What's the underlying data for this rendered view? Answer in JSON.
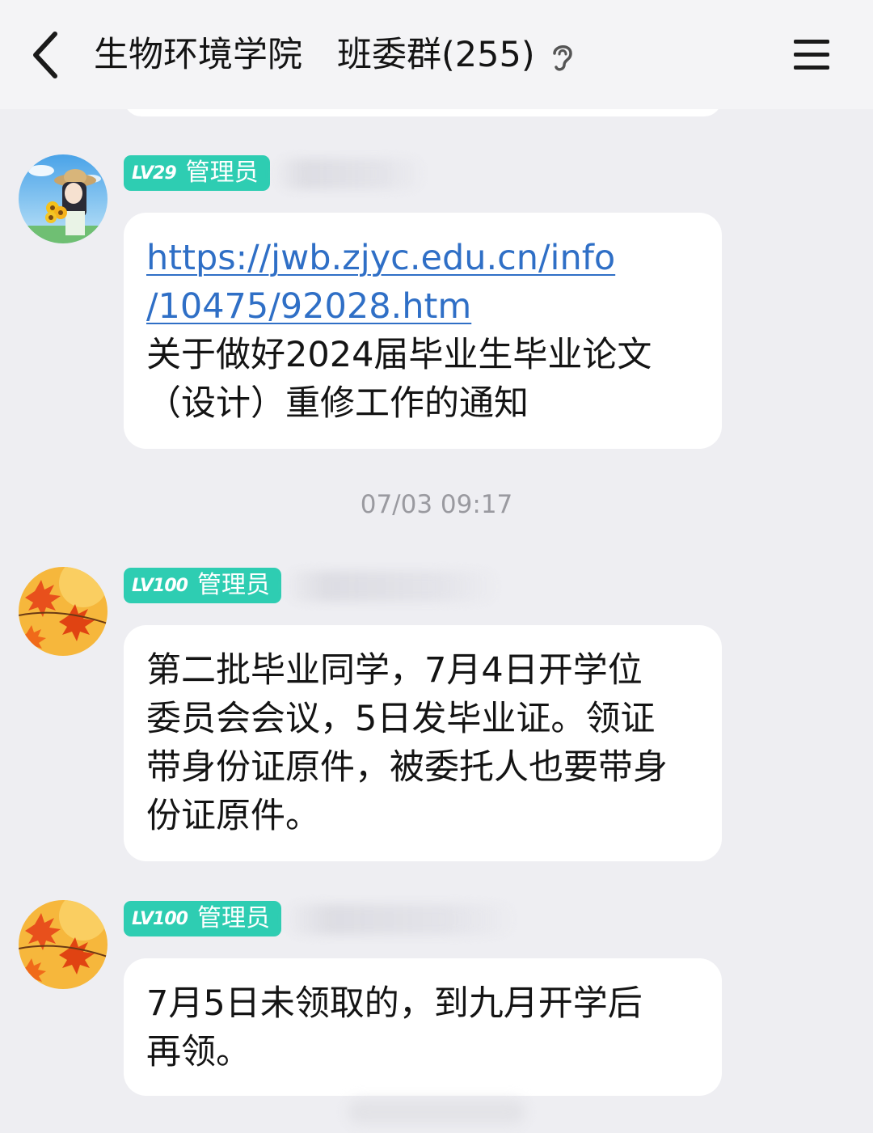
{
  "header": {
    "title": "生物环境学院　班委群(255)",
    "back_icon": "chevron-left-icon",
    "ear_icon": "ear-icon",
    "menu_icon": "hamburger-menu-icon"
  },
  "messages": [
    {
      "badge_level": "LV29",
      "badge_role": "管理员",
      "link_lines": [
        "https://jwb.zjyc.edu.cn/info",
        "/10475/92028.htm"
      ],
      "text_lines": [
        "关于做好2024届毕业生毕业论文",
        "（设计）重修工作的通知"
      ]
    },
    {
      "badge_level": "LV100",
      "badge_role": "管理员",
      "text_lines": [
        "第二批毕业同学，7月4日开学位",
        "委员会会议，5日发毕业证。领证",
        "带身份证原件，被委托人也要带身",
        "份证原件。"
      ]
    },
    {
      "badge_level": "LV100",
      "badge_role": "管理员",
      "text_lines": [
        "7月5日未领取的，到九月开学后",
        "再领。"
      ]
    }
  ],
  "timestamp": "07/03 09:17",
  "colors": {
    "background": "#eeeef2",
    "badge": "#2ecdb2",
    "link": "#2f6fc6",
    "bubble": "#ffffff"
  }
}
